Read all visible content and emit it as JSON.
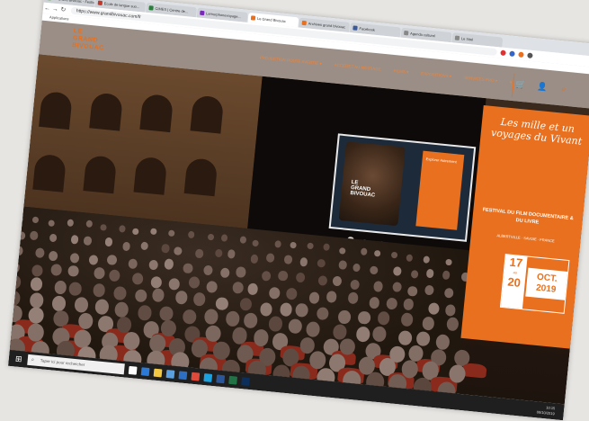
{
  "browser": {
    "tabs": [
      {
        "label": "Le Grand Bivouac - Festival",
        "color": "#4a8f3c",
        "active": false
      },
      {
        "label": "Ecole de langue suo...",
        "color": "#c0392b",
        "active": false
      },
      {
        "label": "CIMES | Centre de...",
        "color": "#2a7f3a",
        "active": false
      },
      {
        "label": "Lemurphonevoyage...",
        "color": "#7a2ab8",
        "active": false
      },
      {
        "label": "Le Grand Bivouac",
        "color": "#e8701e",
        "active": true
      },
      {
        "label": "Archives grand bivouac",
        "color": "#e8701e",
        "active": false
      },
      {
        "label": "Facebook",
        "color": "#3b5998",
        "active": false
      },
      {
        "label": "Agenda culturel",
        "color": "#888888",
        "active": false
      },
      {
        "label": "Le Sitel",
        "color": "#888888",
        "active": false
      }
    ],
    "url": "https://www.grandbivouac.com/fr",
    "bookmarks": "Applications"
  },
  "site": {
    "logo_line1": "LE",
    "logo_line2": "GRAND",
    "logo_line3": "BIVOUAC",
    "menu": [
      "PROJECTION ROUTE AVERTIE ▾",
      "ACCEDEZ AU MESSAGE",
      "FILMS ▾",
      "EXPOSITIONS ▾",
      "SERVICES PRO ▾"
    ],
    "menu_extra": "▾",
    "icons": [
      "cart-icon",
      "account-icon",
      "search-icon"
    ]
  },
  "projection": {
    "title_line1": "LE",
    "title_line2": "GRAND",
    "title_line3": "BIVOUAC",
    "panel_text": "Explorer Autrement"
  },
  "festival": {
    "title": "Les mille et un voyages du Vivant",
    "subtitle": "FESTIVAL DU FILM DOCUMENTAIRE & DU LIVRE",
    "place": "ALBERTVILLE · SAVOIE · FRANCE",
    "day_start": "17",
    "au": "au",
    "day_end": "20",
    "month": "OCT.",
    "year": "2019",
    "accent": "#e8701e"
  },
  "taskbar": {
    "search_placeholder": "Taper ici pour rechercher",
    "apps": [
      {
        "name": "task-view",
        "color": "#ffffff"
      },
      {
        "name": "edge",
        "color": "#2b7ad6"
      },
      {
        "name": "file-explorer",
        "color": "#f2c744"
      },
      {
        "name": "store",
        "color": "#5aa0e0"
      },
      {
        "name": "mail",
        "color": "#2d6fc2"
      },
      {
        "name": "chrome",
        "color": "#e04a3a"
      },
      {
        "name": "skype",
        "color": "#1ba0e0"
      },
      {
        "name": "word",
        "color": "#2b579a"
      },
      {
        "name": "excel",
        "color": "#217346"
      },
      {
        "name": "photoshop",
        "color": "#0b2f5a"
      }
    ],
    "time": "10:15",
    "date": "08/10/2019"
  }
}
